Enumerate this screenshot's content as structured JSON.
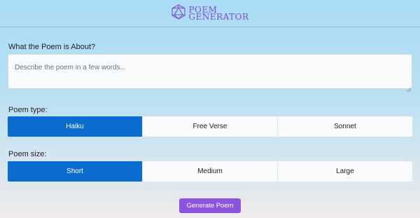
{
  "header": {
    "logo_line1": "POEM",
    "logo_line2": "GENERATOR"
  },
  "about": {
    "label": "What the Poem is About?",
    "placeholder": "Describe the poem in a few words..."
  },
  "poem_type": {
    "label": "Poem type:",
    "options": [
      "Haiku",
      "Free Verse",
      "Sonnet"
    ],
    "selected": "Haiku"
  },
  "poem_size": {
    "label": "Poem size:",
    "options": [
      "Short",
      "Medium",
      "Large"
    ],
    "selected": "Short"
  },
  "generate_label": "Generate Poem",
  "colors": {
    "accent": "#0b6cd0",
    "button": "#8b55e0",
    "logo": "#7d4fc9"
  }
}
